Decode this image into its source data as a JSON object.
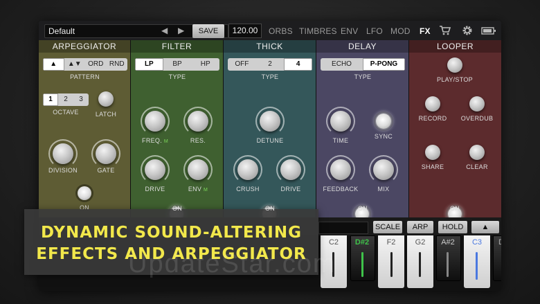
{
  "topbar": {
    "preset_name": "Default",
    "prev_arrow": "◀",
    "next_arrow": "▶",
    "save_label": "SAVE",
    "tempo": "120.00",
    "nav": [
      "ORBS",
      "TIMBRES",
      "ENV",
      "LFO",
      "MOD",
      "FX"
    ],
    "active_nav": "FX"
  },
  "panels": {
    "arpeggiator": {
      "title": "ARPEGGIATOR",
      "pattern": [
        "▲",
        "▲▼",
        "ORD",
        "RND"
      ],
      "pattern_label": "PATTERN",
      "octave": [
        "1",
        "2",
        "3"
      ],
      "octave_label": "OCTAVE",
      "latch_label": "LATCH",
      "division_label": "DIVISION",
      "gate_label": "GATE",
      "on_label": "ON",
      "color": "#5e5c34"
    },
    "filter": {
      "title": "FILTER",
      "type": [
        "LP",
        "BP",
        "HP"
      ],
      "type_label": "TYPE",
      "freq_label": "FREQ.",
      "mod_mark": "M",
      "res_label": "RES.",
      "drive_label": "DRIVE",
      "env_label": "ENV",
      "on_label": "ON",
      "color": "#3f6030"
    },
    "thick": {
      "title": "THICK",
      "type": [
        "OFF",
        "2",
        "4"
      ],
      "type_label": "TYPE",
      "detune_label": "DETUNE",
      "crush_label": "CRUSH",
      "drive_label": "DRIVE",
      "on_label": "ON",
      "color": "#34575a"
    },
    "delay": {
      "title": "DELAY",
      "type": [
        "ECHO",
        "P-PONG"
      ],
      "type_label": "TYPE",
      "time_label": "TIME",
      "sync_label": "SYNC",
      "feedback_label": "FEEDBACK",
      "mix_label": "MIX",
      "on_label": "ON",
      "color": "#4b4763"
    },
    "looper": {
      "title": "LOOPER",
      "playstop_label": "PLAY/STOP",
      "record_label": "RECORD",
      "overdub_label": "OVERDUB",
      "share_label": "SHARE",
      "clear_label": "CLEAR",
      "on_label": "ON",
      "color": "#5c2b2d"
    }
  },
  "keyboard": {
    "scale_label": "SCALE",
    "arp_label": "ARP",
    "hold_label": "HOLD",
    "up_label": "▲",
    "keys": [
      "C2",
      "D#2",
      "F2",
      "G2",
      "A#2",
      "C3",
      "D"
    ],
    "key_colors": [
      "#cfcfcf",
      "#3fc34a",
      "#cfcfcf",
      "#cfcfcf",
      "#cfcfcf",
      "#4a78e0",
      "#cfcfcf"
    ]
  },
  "caption": {
    "line1": "DYNAMIC SOUND-ALTERING",
    "line2": "EFFECTS AND ARPEGGIATOR"
  },
  "watermark": "UpdateStar.com"
}
